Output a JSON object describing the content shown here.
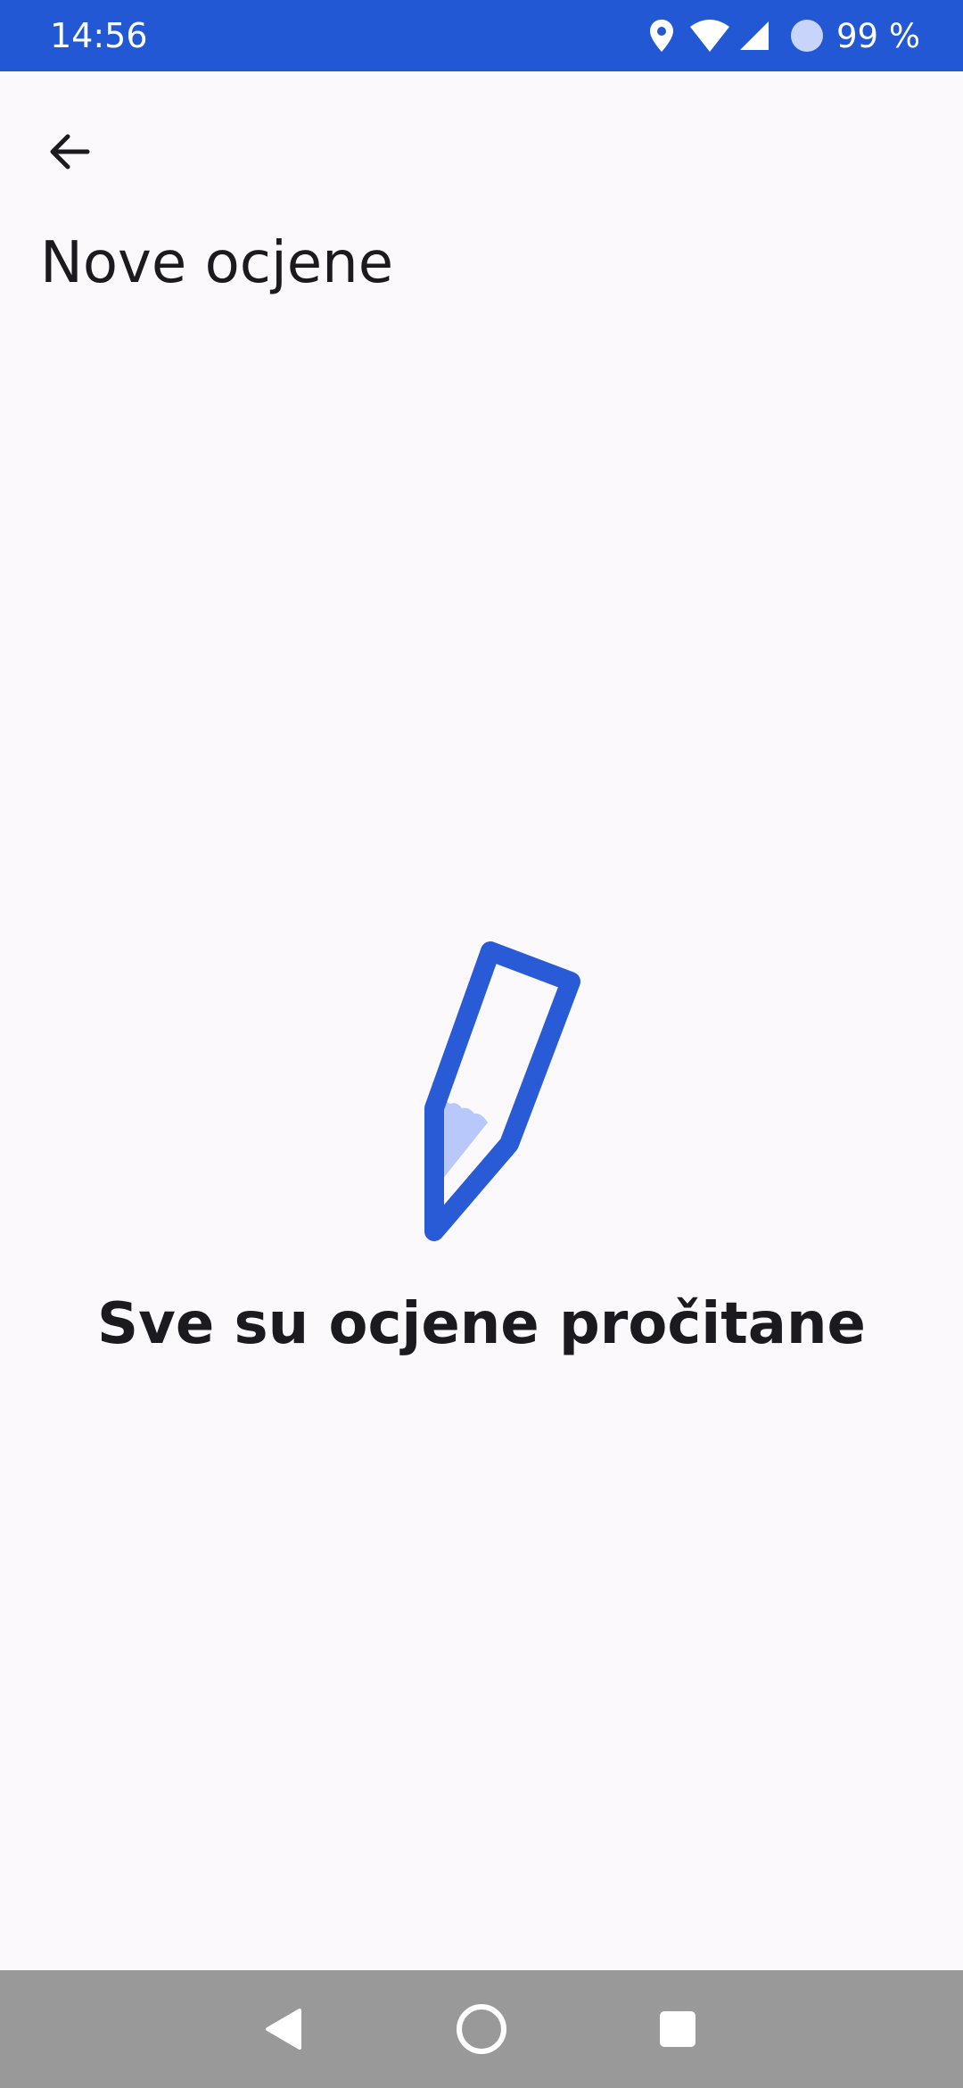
{
  "status_bar": {
    "time": "14:56",
    "battery": "99 %",
    "background_color": "#2258d4",
    "icons": [
      "location-icon",
      "wifi-icon",
      "cell-signal-icon",
      "circle-status-icon"
    ]
  },
  "header": {
    "back_icon": "arrow-back-icon",
    "title": "Nove ocjene"
  },
  "empty_state": {
    "illustration": "pencil-icon",
    "message": "Sve su ocjene pročitane",
    "accent_color": "#2a5bd7",
    "fill_color": "#b8c8fb"
  },
  "nav_bar": {
    "buttons": [
      "back-triangle-icon",
      "home-circle-icon",
      "recents-square-icon"
    ]
  }
}
